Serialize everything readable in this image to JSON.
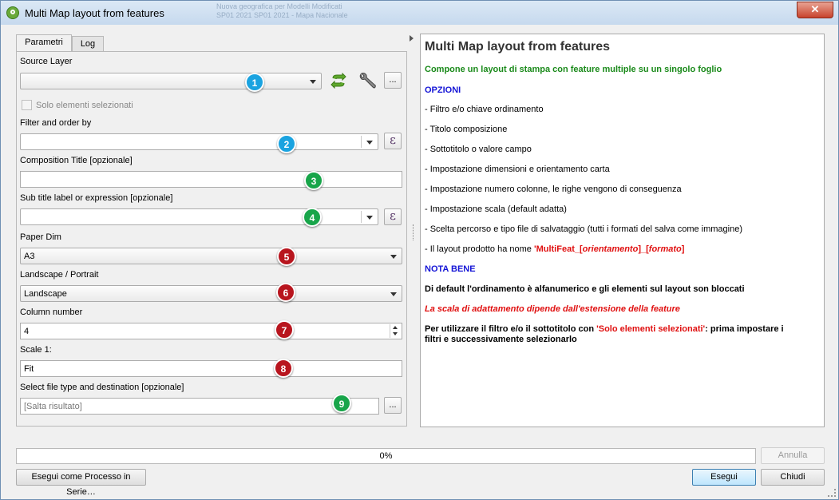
{
  "window": {
    "title": "Multi Map layout from features",
    "ghost_text": "Nuova geografica per Modelli Modificati\nSP01 2021 SP01 2021 - Mapa Nacionale"
  },
  "tabs": [
    "Parametri",
    "Log"
  ],
  "form": {
    "source_layer": {
      "label": "Source Layer",
      "value": "",
      "options_button": "..."
    },
    "selected_only": {
      "label": "Solo elementi selezionati",
      "checked": false
    },
    "filter": {
      "label": "Filter and order by",
      "value": "",
      "expr_button": "ε"
    },
    "composition_title": {
      "label": "Composition Title [opzionale]",
      "value": ""
    },
    "subtitle": {
      "label": "Sub title label or expression [opzionale]",
      "value": "",
      "expr_button": "ε"
    },
    "paper_dim": {
      "label": "Paper Dim",
      "value": "A3"
    },
    "orientation": {
      "label": "Landscape / Portrait",
      "value": "Landscape"
    },
    "columns": {
      "label": "Column number",
      "value": "4"
    },
    "scale": {
      "label": "Scale 1:",
      "value": "Fit"
    },
    "output": {
      "label": "Select file type and destination [opzionale]",
      "value": "[Salta risultato]",
      "browse_button": "..."
    }
  },
  "badges": [
    "1",
    "2",
    "3",
    "4",
    "5",
    "6",
    "7",
    "8",
    "9"
  ],
  "help": {
    "title": "Multi Map layout from features",
    "subtitle": "Compone un layout di stampa con feature multiple su un singolo foglio",
    "options_heading": "OPZIONI",
    "items": [
      "- Filtro e/o chiave ordinamento",
      "- Titolo composizione",
      "- Sottotitolo o valore campo",
      "- Impostazione dimensioni e orientamento carta",
      "- Impostazione numero colonne, le righe vengono di conseguenza",
      "- Impostazione scala (default adatta)",
      "- Scelta percorso e tipo file di salvataggio (tutti i formati del salva come immagine)"
    ],
    "layout_name_prefix": "- Il layout prodotto ha nome ",
    "layout_name_a": "'MultiFeat_[",
    "layout_name_b": "orientamento",
    "layout_name_c": "]_[",
    "layout_name_d": "formato",
    "layout_name_e": "]",
    "note_heading": "NOTA BENE",
    "note1": "Di default l'ordinamento è alfanumerico e gli elementi sul layout son bloccati",
    "note2": "La scala di adattamento dipende dall'estensione della feature",
    "note3_a": "Per utilizzare il filtro e/o il sottotitolo con ",
    "note3_b": "'Solo elementi selezionati'",
    "note3_c": ": prima impostare i",
    "note3_d": "filtri e successivamente selezionarlo"
  },
  "progress": {
    "text": "0%",
    "value": 0
  },
  "buttons": {
    "cancel": "Annulla",
    "batch": "Esegui come Processo in Serie…",
    "run": "Esegui",
    "close": "Chiudi"
  },
  "colors": {
    "badge_blue": "#1aa3e0",
    "badge_green": "#18a54a",
    "badge_red": "#b8151e"
  }
}
